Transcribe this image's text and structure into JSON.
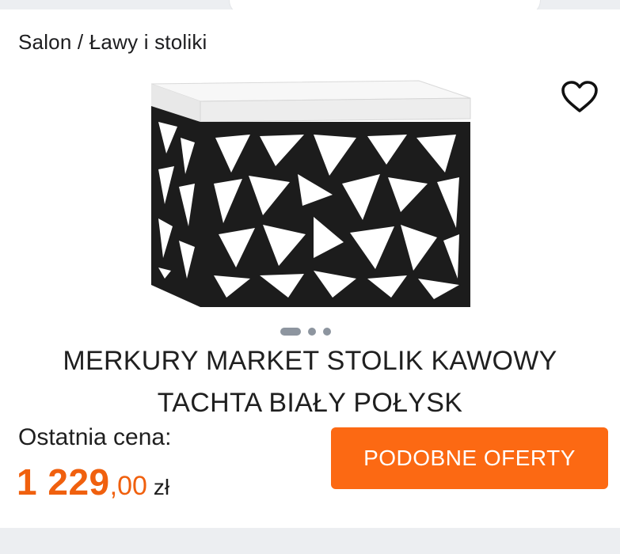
{
  "breadcrumb": {
    "text": "Salon / Ławy i stoliki"
  },
  "favorite": {
    "icon": "heart-outline-icon"
  },
  "gallery": {
    "image": "coffee-table-product-photo",
    "dots": 3,
    "active_index": 0
  },
  "product": {
    "title_line1": "MERKURY MARKET STOLIK KAWOWY",
    "title_line2": "TACHTA BIAŁY POŁYSK"
  },
  "price": {
    "label": "Ostatnia cena:",
    "integer": "1 229",
    "decimal": ",00",
    "currency": "zł"
  },
  "actions": {
    "similar_offers": "PODOBNE OFERTY"
  },
  "colors": {
    "accent": "#fc6913",
    "price": "#f0600e",
    "background": "#eceef1"
  }
}
